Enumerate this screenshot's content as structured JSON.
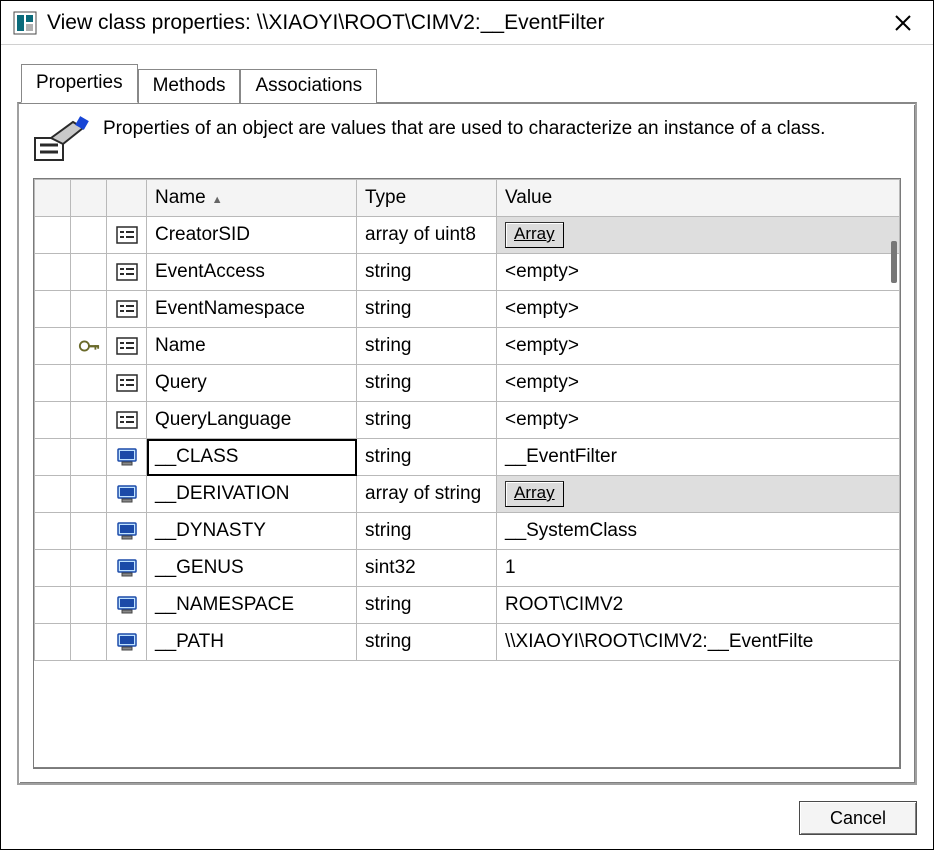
{
  "window": {
    "title": "View class properties: \\\\XIAOYI\\ROOT\\CIMV2:__EventFilter"
  },
  "tabs": {
    "properties": "Properties",
    "methods": "Methods",
    "associations": "Associations",
    "active": "properties"
  },
  "description": "Properties of an object are values that are used to characterize an instance of a class.",
  "columns": {
    "name": "Name",
    "type": "Type",
    "value": "Value"
  },
  "array_button_label": "Array",
  "rows": [
    {
      "icon": "prop",
      "key": false,
      "selected": false,
      "name": "CreatorSID",
      "type": "array of uint8",
      "value_kind": "array",
      "value": ""
    },
    {
      "icon": "prop",
      "key": false,
      "selected": false,
      "name": "EventAccess",
      "type": "string",
      "value_kind": "text",
      "value": "<empty>"
    },
    {
      "icon": "prop",
      "key": false,
      "selected": false,
      "name": "EventNamespace",
      "type": "string",
      "value_kind": "text",
      "value": "<empty>"
    },
    {
      "icon": "prop",
      "key": true,
      "selected": false,
      "name": "Name",
      "type": "string",
      "value_kind": "text",
      "value": "<empty>"
    },
    {
      "icon": "prop",
      "key": false,
      "selected": false,
      "name": "Query",
      "type": "string",
      "value_kind": "text",
      "value": "<empty>"
    },
    {
      "icon": "prop",
      "key": false,
      "selected": false,
      "name": "QueryLanguage",
      "type": "string",
      "value_kind": "text",
      "value": "<empty>"
    },
    {
      "icon": "system",
      "key": false,
      "selected": true,
      "name": "__CLASS",
      "type": "string",
      "value_kind": "text",
      "value": "__EventFilter"
    },
    {
      "icon": "system",
      "key": false,
      "selected": false,
      "name": "__DERIVATION",
      "type": "array of string",
      "value_kind": "array",
      "value": ""
    },
    {
      "icon": "system",
      "key": false,
      "selected": false,
      "name": "__DYNASTY",
      "type": "string",
      "value_kind": "text",
      "value": "__SystemClass"
    },
    {
      "icon": "system",
      "key": false,
      "selected": false,
      "name": "__GENUS",
      "type": "sint32",
      "value_kind": "text",
      "value": "1"
    },
    {
      "icon": "system",
      "key": false,
      "selected": false,
      "name": "__NAMESPACE",
      "type": "string",
      "value_kind": "text",
      "value": "ROOT\\CIMV2"
    },
    {
      "icon": "system",
      "key": false,
      "selected": false,
      "name": "__PATH",
      "type": "string",
      "value_kind": "text",
      "value": "\\\\XIAOYI\\ROOT\\CIMV2:__EventFilte"
    }
  ],
  "buttons": {
    "cancel": "Cancel"
  }
}
